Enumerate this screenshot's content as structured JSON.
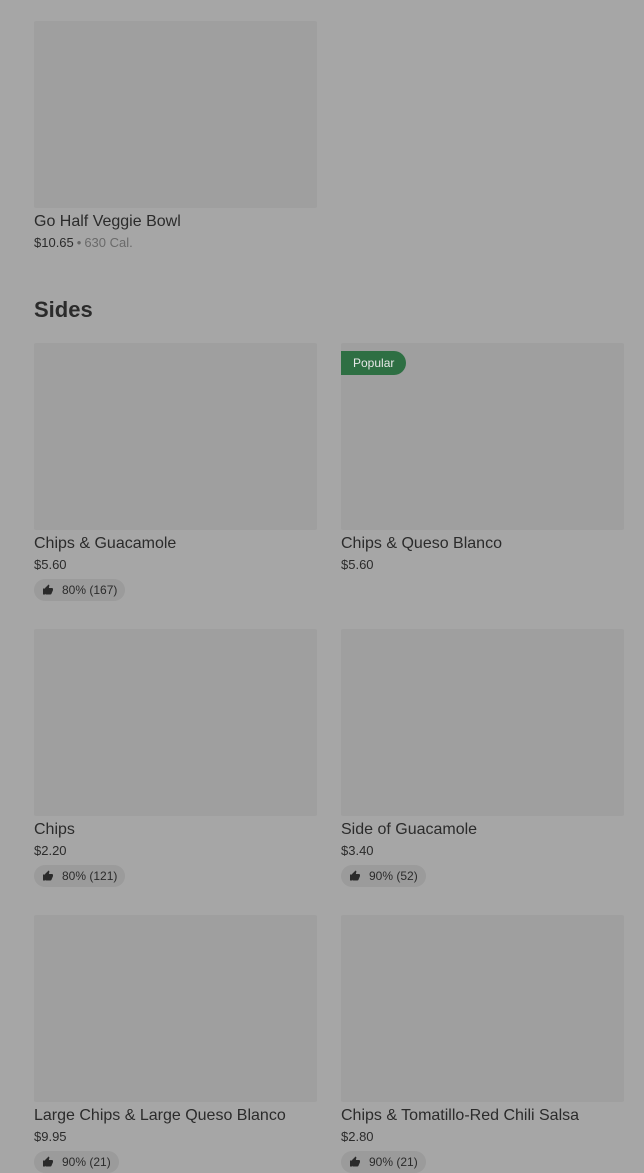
{
  "top_item": {
    "name": "Go Half Veggie Bowl",
    "price": "$10.65",
    "separator": "•",
    "calories": "630 Cal."
  },
  "sides": {
    "title": "Sides",
    "items": [
      {
        "name": "Chips & Guacamole",
        "price": "$5.60",
        "rating": "80% (167)",
        "badge": ""
      },
      {
        "name": "Chips & Queso Blanco",
        "price": "$5.60",
        "rating": "",
        "badge": "Popular"
      },
      {
        "name": "Chips",
        "price": "$2.20",
        "rating": "80% (121)",
        "badge": ""
      },
      {
        "name": "Side of Guacamole",
        "price": "$3.40",
        "rating": "90% (52)",
        "badge": ""
      },
      {
        "name": "Large Chips & Large Queso Blanco",
        "price": "$9.95",
        "rating": "90% (21)",
        "badge": ""
      },
      {
        "name": "Chips & Tomatillo-Red Chili Salsa",
        "price": "$2.80",
        "rating": "90% (21)",
        "badge": ""
      }
    ]
  },
  "colors": {
    "background": "#a6a6a6",
    "image_placeholder": "#9f9f9f",
    "badge_green": "#2e6f43",
    "text": "#2b2b2b"
  },
  "icons": {
    "rating": "thumbs-up-icon"
  }
}
